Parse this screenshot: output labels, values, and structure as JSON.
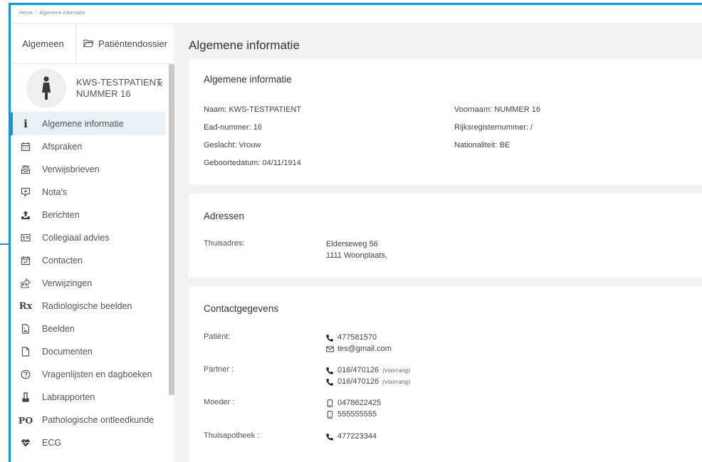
{
  "breadcrumb": {
    "home": "Home",
    "separator": "/",
    "current": "Algemene informatie"
  },
  "sidebar": {
    "tabs": [
      {
        "label": "Algemeen",
        "icon": "none"
      },
      {
        "label": "Patiëntendossier",
        "icon": "folder-open-icon"
      }
    ],
    "patient": {
      "line1": "KWS-TESTPATIENT",
      "line2": "NUMMER 16",
      "close": "×"
    },
    "items": [
      {
        "label": "Algemene informatie",
        "icon": "info-icon",
        "icon_text": "i",
        "active": true
      },
      {
        "label": "Afspraken",
        "icon": "calendar-icon"
      },
      {
        "label": "Verwijsbrieven",
        "icon": "referral-letter-icon"
      },
      {
        "label": "Nota's",
        "icon": "note-plus-icon"
      },
      {
        "label": "Berichten",
        "icon": "upload-tray-icon"
      },
      {
        "label": "Collegiaal advies",
        "icon": "id-card-icon"
      },
      {
        "label": "Contacten",
        "icon": "calendar-check-icon"
      },
      {
        "label": "Verwijzingen",
        "icon": "share-icon"
      },
      {
        "label": "Radiologische beelden",
        "icon": "rx-icon",
        "icon_text": "Rx"
      },
      {
        "label": "Beelden",
        "icon": "image-file-icon"
      },
      {
        "label": "Documenten",
        "icon": "document-icon"
      },
      {
        "label": "Vragenlijsten en dagboeken",
        "icon": "question-circle-icon"
      },
      {
        "label": "Labrapporten",
        "icon": "flask-icon"
      },
      {
        "label": "Pathologische ontleedkunde",
        "icon": "po-icon",
        "icon_text": "PO"
      },
      {
        "label": "ECG",
        "icon": "heartbeat-icon"
      }
    ]
  },
  "main": {
    "title": "Algemene informatie",
    "general": {
      "title": "Algemene informatie",
      "naam": "Naam: KWS-TESTPATIENT",
      "ead": "Ead-nummer: 16",
      "geslacht": "Geslacht: Vrouw",
      "geboortedatum": "Geboortedatum: 04/11/1914",
      "voornaam": "Voornaam: NUMMER 16",
      "rijksregister": "Rijksregisternummer: /",
      "nationaliteit": "Nationaliteit: BE"
    },
    "addresses": {
      "title": "Adressen",
      "label": "Thuisadres:",
      "line1": "Elderseweg 56",
      "line2": "1111 Woonplaats,"
    },
    "contacts": {
      "title": "Contactgegevens",
      "patient": {
        "label": "Patiënt:",
        "phone": "477581570",
        "email": "tes@gmail.com"
      },
      "partner": {
        "label": "Partner :",
        "phone1": "016/470126",
        "phone2": "016/470126",
        "note": "(voorrang)"
      },
      "moeder": {
        "label": "Moeder :",
        "mobile1": "0478622425",
        "mobile2": "555555555"
      },
      "apotheek": {
        "label": "Thuisapotheek :",
        "phone": "477223344"
      }
    }
  },
  "colors": {
    "accent": "#1b95cf",
    "active_bg": "#e9f1f6",
    "main_bg": "#f2f2f2"
  }
}
